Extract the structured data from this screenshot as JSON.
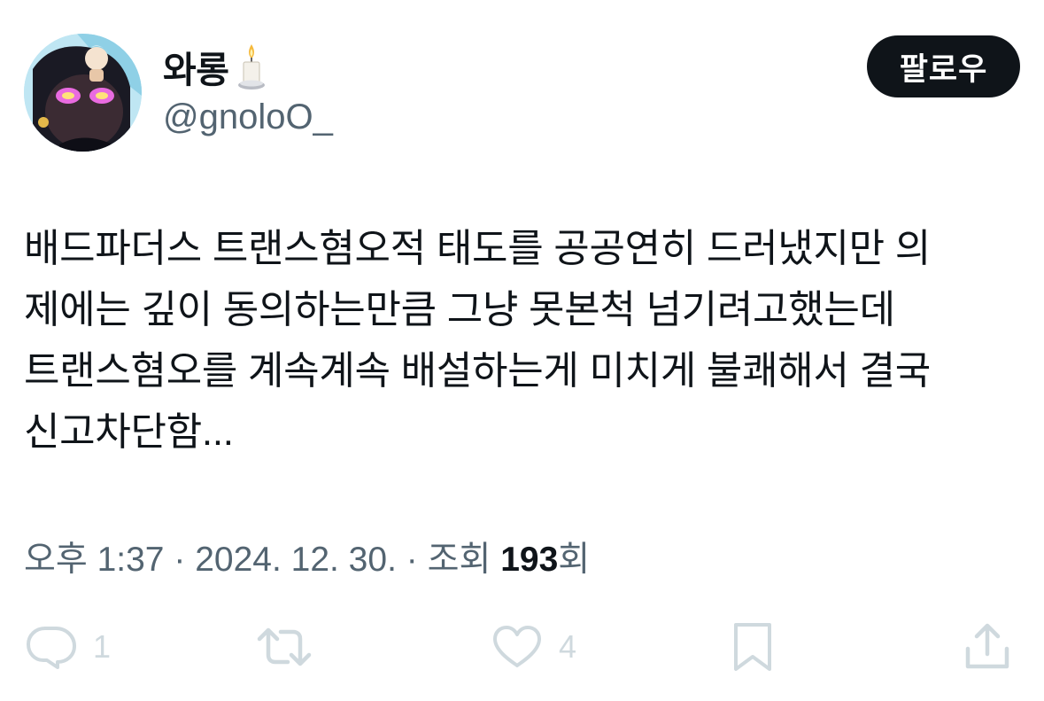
{
  "user": {
    "display_name": "와롱",
    "handle": "@gnoloO_",
    "name_emoji_icon": "candle-icon",
    "avatar_icon": "cartoon-avatar"
  },
  "follow_button": {
    "label": "팔로우"
  },
  "tweet": {
    "text": "배드파더스 트랜스혐오적 태도를 공공연히 드러냈지만 의\n제에는 깊이 동의하는만큼 그냥 못본척 넘기려고했는데\n트랜스혐오를 계속계속 배설하는게 미치게 불쾌해서 결국\n신고차단함..."
  },
  "meta": {
    "time": "오후 1:37",
    "separator": "·",
    "date": "2024. 12. 30.",
    "views_label": "조회",
    "views_count": "193",
    "views_suffix": "회"
  },
  "actions": {
    "reply": {
      "icon": "reply-icon",
      "count": "1"
    },
    "retweet": {
      "icon": "retweet-icon",
      "count": ""
    },
    "like": {
      "icon": "heart-icon",
      "count": "4"
    },
    "bookmark": {
      "icon": "bookmark-icon",
      "count": ""
    },
    "share": {
      "icon": "share-icon",
      "count": ""
    }
  },
  "colors": {
    "text_primary": "#0f1419",
    "text_secondary": "#536471",
    "action_icon": "#cfd9de",
    "button_bg": "#0f1419",
    "button_text": "#ffffff"
  }
}
